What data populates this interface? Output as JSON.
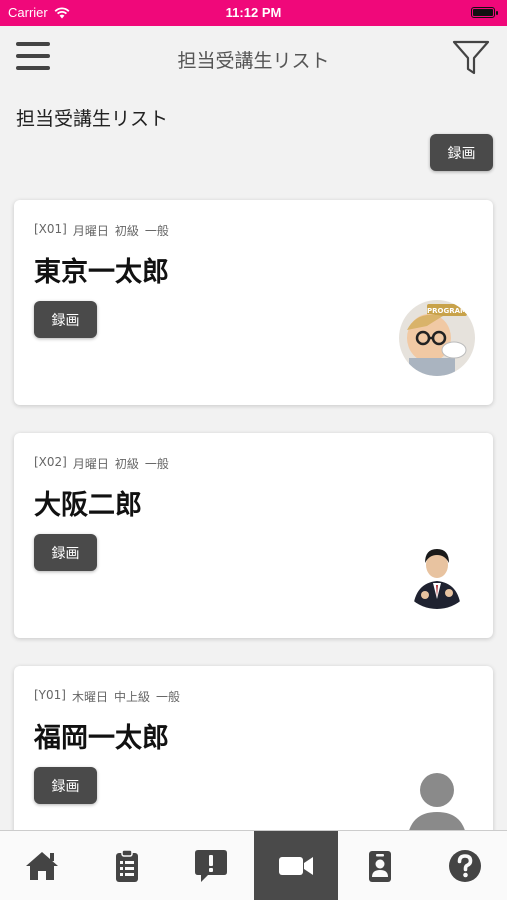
{
  "status_bar": {
    "carrier": "Carrier",
    "time": "11:12 PM"
  },
  "nav": {
    "title": "担当受講生リスト"
  },
  "page": {
    "heading": "担当受講生リスト",
    "record_label": "録画"
  },
  "students": [
    {
      "code": "[X01]",
      "day": "月曜日",
      "level": "初級",
      "type": "一般",
      "name": "東京一太郎",
      "record_label": "録画",
      "avatar": "child-with-glasses-photo"
    },
    {
      "code": "[X02]",
      "day": "月曜日",
      "level": "初級",
      "type": "一般",
      "name": "大阪二郎",
      "record_label": "録画",
      "avatar": "man-in-suit-photo"
    },
    {
      "code": "[Y01]",
      "day": "木曜日",
      "level": "中上級",
      "type": "一般",
      "name": "福岡一太郎",
      "record_label": "録画",
      "avatar": "default-person-icon"
    }
  ],
  "tabs": [
    {
      "icon": "home-icon",
      "active": false
    },
    {
      "icon": "clipboard-list-icon",
      "active": false
    },
    {
      "icon": "exclamation-comment-icon",
      "active": false
    },
    {
      "icon": "video-camera-icon",
      "active": true
    },
    {
      "icon": "id-badge-icon",
      "active": false
    },
    {
      "icon": "question-circle-icon",
      "active": false
    }
  ],
  "colors": {
    "status_bar": "#f0087a",
    "button": "#4a4a4a",
    "active_tab": "#4a4a4a"
  }
}
